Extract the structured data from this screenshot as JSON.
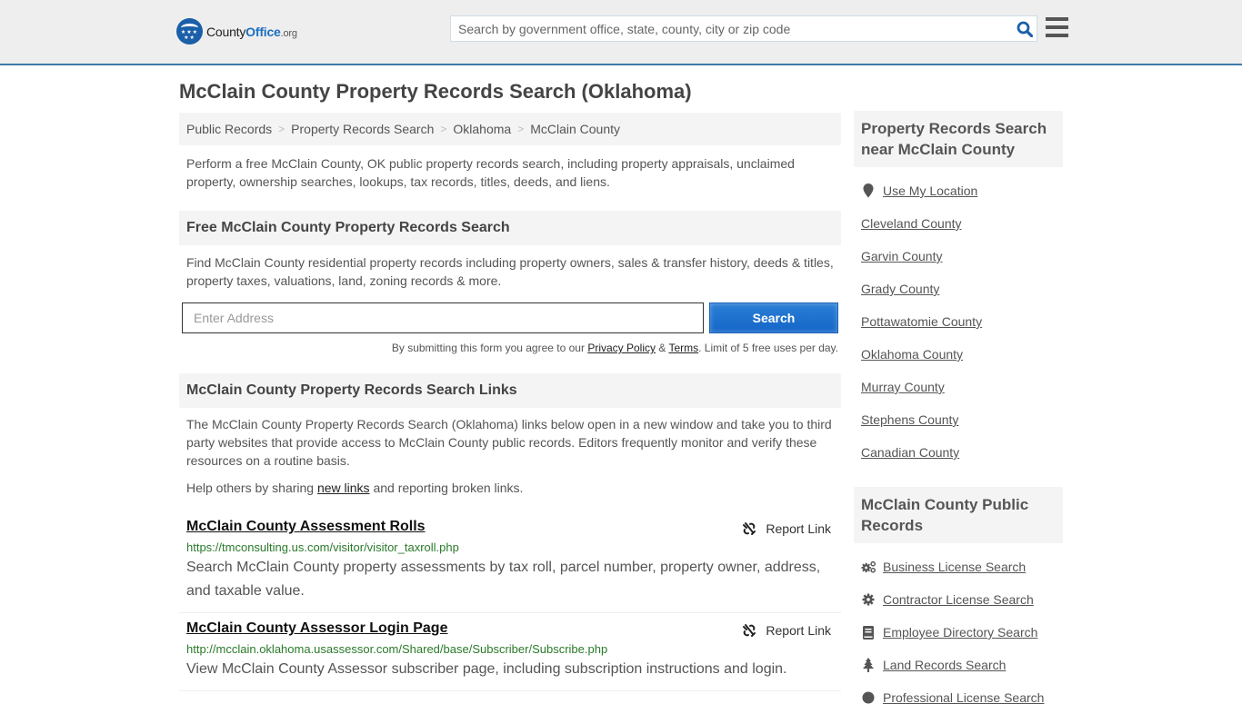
{
  "header": {
    "logo": {
      "name_part1": "County",
      "name_part2": "Office",
      "tld": ".org"
    },
    "search_placeholder": "Search by government office, state, county, city or zip code",
    "accent_color": "#3f79a8"
  },
  "page": {
    "title": "McClain County Property Records Search (Oklahoma)"
  },
  "breadcrumb": [
    {
      "label": "Public Records"
    },
    {
      "label": "Property Records Search"
    },
    {
      "label": "Oklahoma"
    },
    {
      "label": "McClain County"
    }
  ],
  "intro": "Perform a free McClain County, OK public property records search, including property appraisals, unclaimed property, ownership searches, lookups, tax records, titles, deeds, and liens.",
  "free_search": {
    "heading": "Free McClain County Property Records Search",
    "description": "Find McClain County residential property records including property owners, sales & transfer history, deeds & titles, property taxes, valuations, land, zoning records & more.",
    "address_placeholder": "Enter Address",
    "address_value": "",
    "button_label": "Search",
    "disclaimer_prefix": "By submitting this form you agree to our ",
    "privacy_label": "Privacy Policy",
    "amp": " & ",
    "terms_label": "Terms",
    "disclaimer_suffix": ". Limit of 5 free uses per day."
  },
  "links_section": {
    "heading": "McClain County Property Records Search Links",
    "description": "The McClain County Property Records Search (Oklahoma) links below open in a new window and take you to third party websites that provide access to McClain County public records. Editors frequently monitor and verify these resources on a routine basis.",
    "help_prefix": "Help others by sharing ",
    "help_link": "new links",
    "help_suffix": " and reporting broken links.",
    "report_label": "Report Link",
    "entries": [
      {
        "title": "McClain County Assessment Rolls",
        "url": "https://tmconsulting.us.com/visitor/visitor_taxroll.php",
        "description": "Search McClain County property assessments by tax roll, parcel number, property owner, address, and taxable value."
      },
      {
        "title": "McClain County Assessor Login Page",
        "url": "http://mcclain.oklahoma.usassessor.com/Shared/base/Subscriber/Subscribe.php",
        "description": "View McClain County Assessor subscriber page, including subscription instructions and login."
      }
    ]
  },
  "sidebar": {
    "nearby": {
      "heading": "Property Records Search near McClain County",
      "use_location": "Use My Location",
      "counties": [
        "Cleveland County",
        "Garvin County",
        "Grady County",
        "Pottawatomie County",
        "Oklahoma County",
        "Murray County",
        "Stephens County",
        "Canadian County"
      ]
    },
    "public_records": {
      "heading": "McClain County Public Records",
      "items": [
        {
          "label": "Business License Search",
          "icon": "gears-icon"
        },
        {
          "label": "Contractor License Search",
          "icon": "gear-icon"
        },
        {
          "label": "Employee Directory Search",
          "icon": "book-icon"
        },
        {
          "label": "Land Records Search",
          "icon": "tree-icon"
        },
        {
          "label": "Professional License Search",
          "icon": "badge-icon"
        }
      ]
    }
  }
}
